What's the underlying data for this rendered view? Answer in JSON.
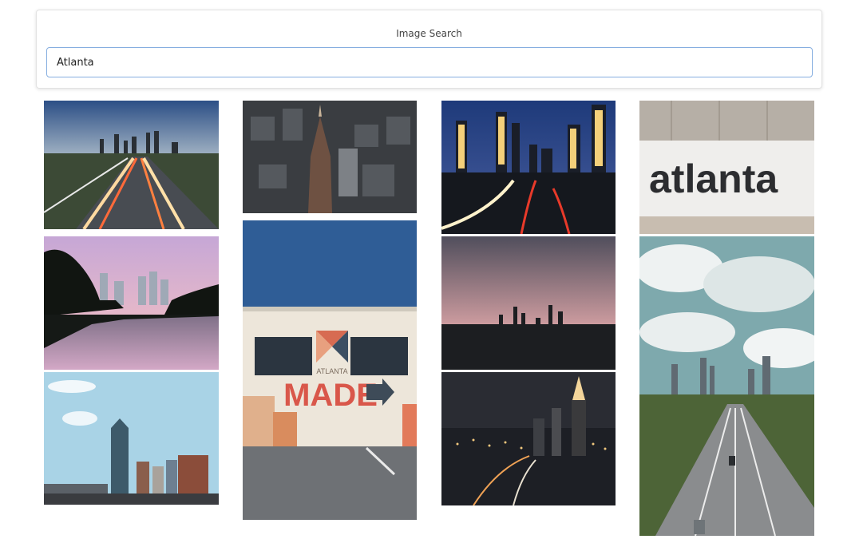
{
  "search": {
    "title": "Image Search",
    "query": "Atlanta"
  },
  "gallery": {
    "images": [
      {
        "name": "image-highway-light-trails-sunset"
      },
      {
        "name": "image-aerial-downtown-tower"
      },
      {
        "name": "image-night-skyline-light-trails"
      },
      {
        "name": "image-atlanta-wall-lettering",
        "text": "atlanta"
      },
      {
        "name": "image-lake-reflection-skyline"
      },
      {
        "name": "image-atlanta-made-mural",
        "text_small": "ATLANTA",
        "text_large": "MADE"
      },
      {
        "name": "image-dusk-skyline-silhouette"
      },
      {
        "name": "image-daytime-skyscraper-blue-sky"
      },
      {
        "name": "image-night-skyline-lit-spire"
      },
      {
        "name": "image-cloudy-sky-freeway-skyline"
      }
    ]
  }
}
